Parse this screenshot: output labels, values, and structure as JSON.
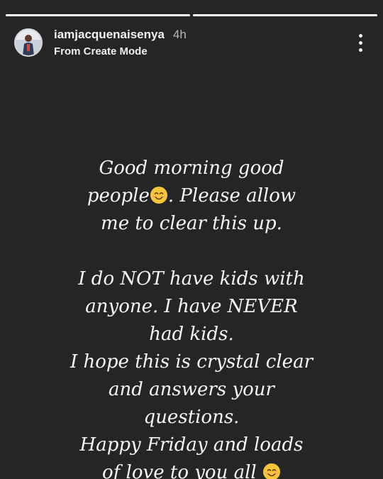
{
  "progress": {
    "segments": [
      {
        "fill_percent": 100
      },
      {
        "fill_percent": 100
      }
    ]
  },
  "header": {
    "username": "iamjacquenaisenya",
    "time": "4h",
    "subtitle": "From Create Mode",
    "more_icon": "more-vertical-icon"
  },
  "story": {
    "lines": {
      "l1": "Good morning good",
      "l2a": "people",
      "l2b": ". Please allow",
      "l3": "me to clear this up.",
      "l4": "I do NOT have kids with",
      "l5": "anyone. I have NEVER",
      "l6": "had kids.",
      "l7": "I hope this is crystal clear",
      "l8": "and answers your",
      "l9": "questions.",
      "l10": "Happy Friday and loads",
      "l11": "of love to you all"
    },
    "emoji_icon": "smiling-face-emoji-icon",
    "text_color": "#f4f4f4",
    "background_color": "#252525"
  }
}
